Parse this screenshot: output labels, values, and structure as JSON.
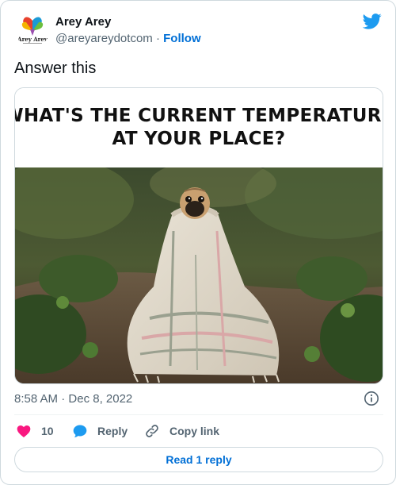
{
  "author": {
    "name": "Arey Arey",
    "handle": "@areyareydotcom",
    "separator": "·",
    "follow_label": "Follow",
    "avatar_text": "Arey Arey"
  },
  "tweet": {
    "text": "Answer this"
  },
  "media": {
    "banner_line1": "WHAT'S THE CURRENT TEMPERATURE",
    "banner_line2": "AT YOUR PLACE?"
  },
  "meta": {
    "time": "8:58 AM",
    "separator": "·",
    "date": "Dec 8, 2022"
  },
  "actions": {
    "likes_count": "10",
    "reply_label": "Reply",
    "copy_label": "Copy link"
  },
  "read_replies_label": "Read 1 reply",
  "colors": {
    "accent": "#006fd6",
    "twitter_blue": "#1d9bf0",
    "like_red": "#f91880",
    "secondary_text": "#536471",
    "border": "#cfd9de"
  },
  "icons": [
    "twitter-bird-icon",
    "info-icon",
    "heart-icon",
    "reply-bubble-icon",
    "link-icon"
  ]
}
